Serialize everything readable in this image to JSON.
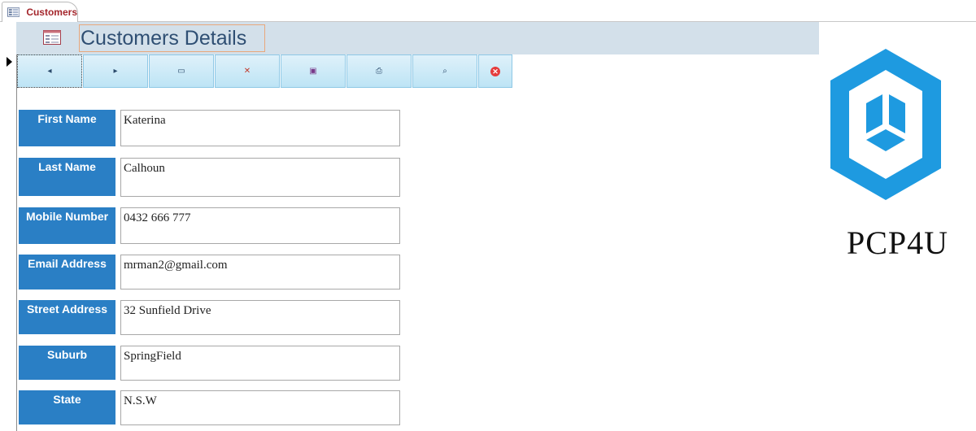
{
  "tab": {
    "label": "Customers",
    "icon": "form-icon"
  },
  "header": {
    "title": "Customers Details",
    "icon": "form-icon"
  },
  "toolbar": {
    "buttons": [
      {
        "name": "previous-record-button",
        "icon": "arrow-left-icon",
        "glyph": "◂"
      },
      {
        "name": "next-record-button",
        "icon": "arrow-right-icon",
        "glyph": "▸"
      },
      {
        "name": "new-record-button",
        "icon": "new-record-icon",
        "glyph": "▭"
      },
      {
        "name": "delete-record-button",
        "icon": "delete-record-icon",
        "glyph": "✕"
      },
      {
        "name": "save-record-button",
        "icon": "save-icon",
        "glyph": "▣"
      },
      {
        "name": "print-button",
        "icon": "print-icon",
        "glyph": "⎙"
      },
      {
        "name": "search-button",
        "icon": "search-icon",
        "glyph": "⌕"
      },
      {
        "name": "close-form-button",
        "icon": "close-icon",
        "glyph": "✕"
      }
    ]
  },
  "fields": [
    {
      "label": "First Name",
      "value": "Katerina"
    },
    {
      "label": "Last Name",
      "value": "Calhoun"
    },
    {
      "label": "Mobile Number",
      "value": "0432 666 777"
    },
    {
      "label": "Email Address",
      "value": "mrman2@gmail.com"
    },
    {
      "label": "Street Address",
      "value": "32 Sunfield Drive"
    },
    {
      "label": "Suburb",
      "value": "SpringField"
    },
    {
      "label": "State",
      "value": "N.S.W"
    }
  ],
  "brand": {
    "name": "PCP4U",
    "logo_icon": "hexagon-cube-logo"
  },
  "colors": {
    "label_bg": "#2a7fc5",
    "header_bg": "#d3e0ea",
    "logo_blue": "#1e9ae0",
    "tab_text": "#a4262c"
  }
}
